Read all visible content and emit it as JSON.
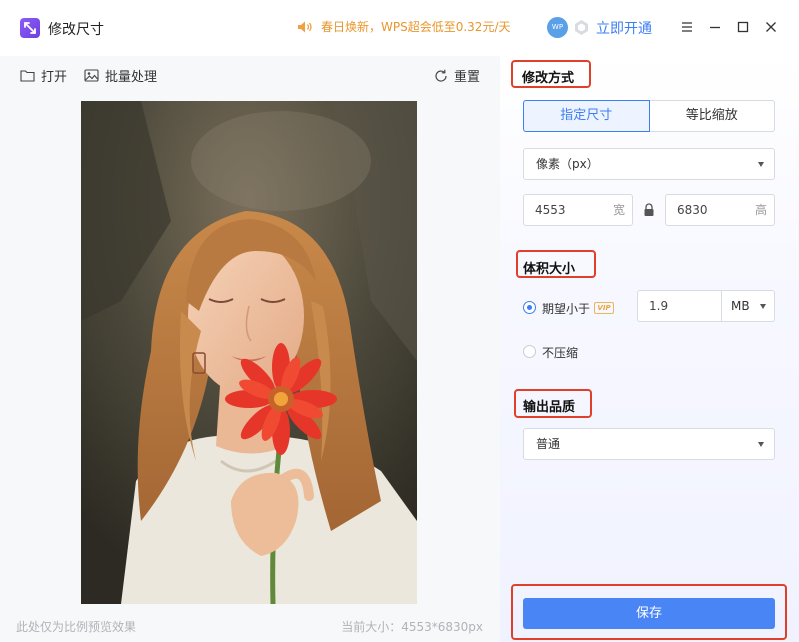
{
  "titlebar": {
    "title": "修改尺寸",
    "promo": "春日焕新，WPS超会低至0.32元/天",
    "wp_badge": "WP",
    "vip_open": "立即开通"
  },
  "toolbar": {
    "open_label": "打开",
    "batch_label": "批量处理",
    "reset_label": "重置"
  },
  "preview": {
    "footer_note": "此处仅为比例预览效果",
    "current_size": "当前大小：4553*6830px"
  },
  "panel": {
    "mode_title": "修改方式",
    "mode_tabs": [
      "指定尺寸",
      "等比缩放"
    ],
    "unit_select": "像素（px）",
    "width_value": "4553",
    "width_unit": "宽",
    "height_value": "6830",
    "height_unit": "高",
    "volume_title": "体积大小",
    "option_expect": "期望小于",
    "vip_tag": "VIP",
    "size_value": "1.9",
    "size_unit": "MB",
    "option_nocompress": "不压缩",
    "quality_title": "输出品质",
    "quality_select": "普通",
    "save_label": "保存"
  },
  "colors": {
    "accent": "#3c7ef3",
    "highlight": "#e0402a",
    "promo": "#e8962c"
  }
}
